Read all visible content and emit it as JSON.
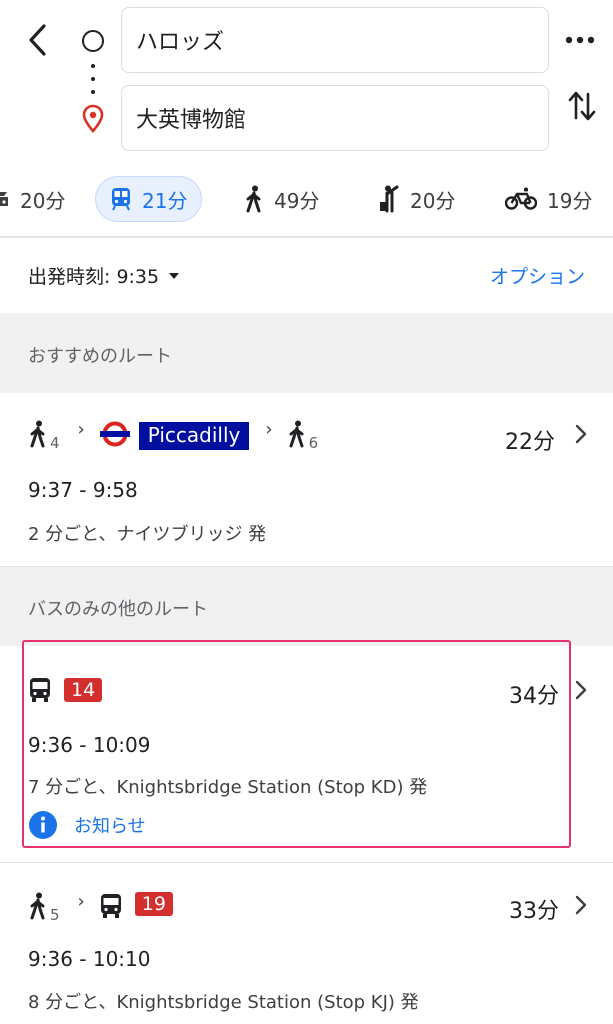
{
  "header": {
    "origin": "ハロッズ",
    "destination": "大英博物館"
  },
  "modes": [
    {
      "icon": "car-icon",
      "label": "20分"
    },
    {
      "icon": "transit-icon",
      "label": "21分",
      "active": true
    },
    {
      "icon": "walk-icon",
      "label": "49分"
    },
    {
      "icon": "ride-hail-icon",
      "label": "20分"
    },
    {
      "icon": "bike-icon",
      "label": "19分"
    }
  ],
  "depart": {
    "label": "出発時刻: 9:35",
    "options": "オプション"
  },
  "recommended": {
    "title": "おすすめのルート",
    "route": {
      "walk_before": "4",
      "line_name": "Piccadilly",
      "walk_after": "6",
      "duration": "22分",
      "times": "9:37 - 9:58",
      "frequency": "2 分ごと、ナイツブリッジ 発"
    }
  },
  "bus_only": {
    "title": "バスのみの他のルート",
    "routes": [
      {
        "bus": "14",
        "duration": "34分",
        "times": "9:36 - 10:09",
        "frequency": "7 分ごと、Knightsbridge Station (Stop KD) 発",
        "notice": "お知らせ"
      },
      {
        "walk_before": "5",
        "bus": "19",
        "duration": "33分",
        "times": "9:36 - 10:10",
        "frequency": "8 分ごと、Knightsbridge Station (Stop KJ) 発"
      }
    ]
  },
  "colors": {
    "accent": "#1a73e8",
    "tube_blue": "#000f9f",
    "bus_red": "#d32f2f",
    "highlight": "#e5336e"
  }
}
